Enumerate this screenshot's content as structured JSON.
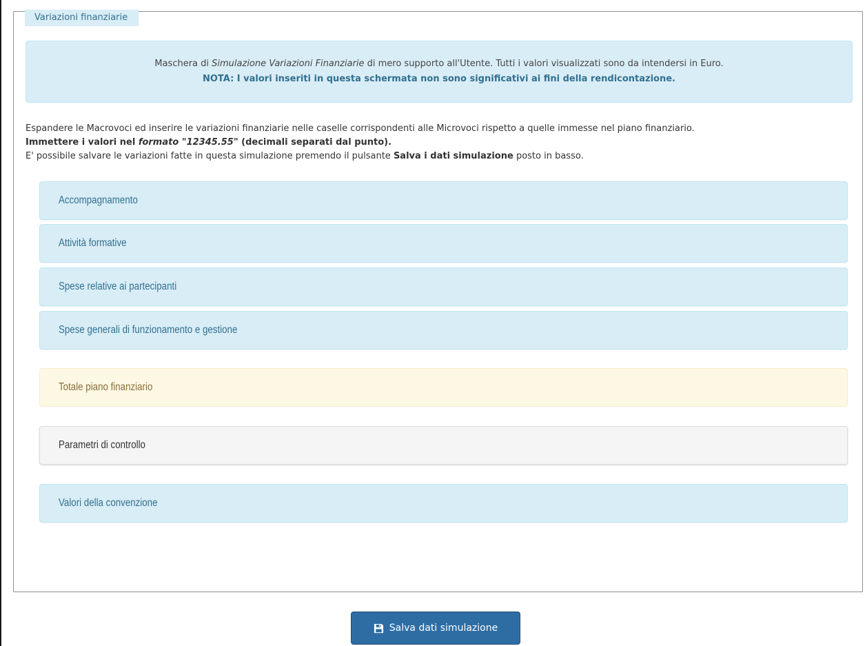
{
  "fieldset": {
    "legend": "Variazioni finanziarie"
  },
  "info_box": {
    "line1_pre": "Maschera di ",
    "line1_em": "Simulazione Variazioni Finanziarie",
    "line1_post": " di mero supporto all'Utente. Tutti i valori visualizzati sono da intendersi in Euro.",
    "line2": "NOTA: I valori inseriti in questa schermata non sono significativi ai fini della rendicontazione."
  },
  "instructions": {
    "line1": "Espandere le Macrovoci ed inserire le variazioni finanziarie nelle caselle corrispondenti alle Microvoci rispetto a quelle immesse nel piano finanziario.",
    "line2_pre": "Immettere i valori nel ",
    "line2_em": "formato \"12345.55\"",
    "line2_post": " (decimali separati dal punto).",
    "line3_pre": "E' possibile salvare le variazioni fatte in questa simulazione premendo il pulsante ",
    "line3_bold": "Salva i dati simulazione",
    "line3_post": " posto in basso."
  },
  "panels": [
    {
      "label": "Accompagnamento",
      "style": "info"
    },
    {
      "label": "Attività formative",
      "style": "info"
    },
    {
      "label": "Spese relative ai partecipanti",
      "style": "info"
    },
    {
      "label": "Spese generali di funzionamento e gestione",
      "style": "info"
    },
    {
      "label": "Totale piano finanziario",
      "style": "warning"
    },
    {
      "label": "Parametri di controllo",
      "style": "default"
    },
    {
      "label": "Valori della convenzione",
      "style": "info"
    }
  ],
  "save_button": {
    "label": "Salva dati simulazione",
    "icon": "floppy-disk-icon"
  },
  "colors": {
    "info_bg": "#d9edf7",
    "info_text": "#31708f",
    "warning_bg": "#fcf8e3",
    "warning_text": "#8a6d3b",
    "default_bg": "#f5f5f5",
    "primary_button": "#2e6da4"
  }
}
